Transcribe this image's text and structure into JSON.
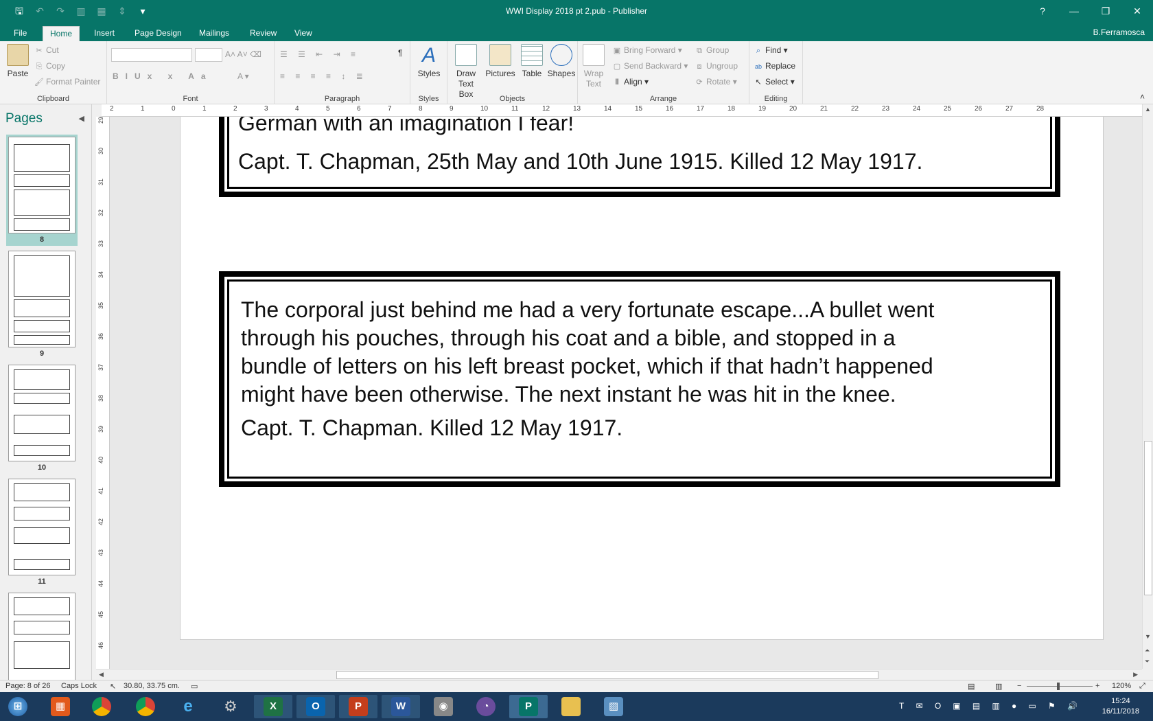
{
  "window": {
    "title": "WWI Display 2018 pt 2.pub - Publisher",
    "help": "?",
    "minimize": "—",
    "restore": "❐",
    "close": "✕"
  },
  "menu": {
    "tabs": [
      "File",
      "Home",
      "Insert",
      "Page Design",
      "Mailings",
      "Review",
      "View"
    ],
    "active": "Home",
    "user": "B.Ferramosca"
  },
  "ribbon": {
    "clipboard": {
      "label": "Clipboard",
      "paste": "Paste",
      "cut": "Cut",
      "copy": "Copy",
      "format_painter": "Format Painter"
    },
    "font": {
      "label": "Font"
    },
    "paragraph": {
      "label": "Paragraph"
    },
    "styles": {
      "label": "Styles",
      "styles_btn": "Styles"
    },
    "objects": {
      "label": "Objects",
      "draw_text_box": "Draw Text Box",
      "pictures": "Pictures",
      "table": "Table",
      "shapes": "Shapes"
    },
    "arrange": {
      "label": "Arrange",
      "wrap_text": "Wrap Text",
      "bring_forward": "Bring Forward",
      "send_backward": "Send Backward",
      "align": "Align",
      "group": "Group",
      "ungroup": "Ungroup",
      "rotate": "Rotate"
    },
    "editing": {
      "label": "Editing",
      "find": "Find",
      "replace": "Replace",
      "select": "Select"
    }
  },
  "pages_pane": {
    "title": "Pages",
    "thumbnails": [
      "8",
      "9",
      "10",
      "11"
    ]
  },
  "document": {
    "box1": {
      "line_partial": "German with an imagination I fear!",
      "attribution": "Capt. T. Chapman, 25th May and 10th June 1915. Killed 12 May 1917."
    },
    "box2": {
      "quote_lines": [
        "The corporal just behind me had a very fortunate escape...A bullet went",
        "through his pouches, through his coat and a bible, and stopped in a",
        "bundle of letters on his left breast pocket, which if that hadn’t happened",
        "might have been otherwise. The next instant he was hit in the knee."
      ],
      "attribution": "Capt. T. Chapman. Killed 12 May 1917."
    }
  },
  "status": {
    "page": "Page: 8 of 26",
    "caps": "Caps Lock",
    "position": "30.80, 33.75 cm.",
    "zoom": "120%"
  },
  "taskbar": {
    "time": "15:24",
    "date": "16/11/2018"
  },
  "colors": {
    "accent": "#077568",
    "taskbar": "#1b3a5c"
  }
}
